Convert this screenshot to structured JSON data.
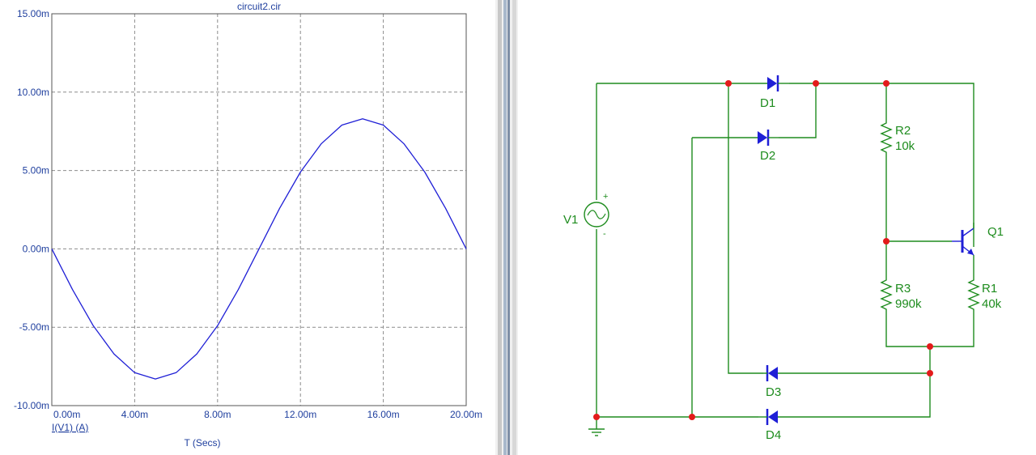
{
  "colors": {
    "axis_text": "#1f3f9e",
    "trace": "#1f1fd6",
    "grid": "#8c8c8c",
    "wire": "#1e8c1e",
    "node": "#e31b1b",
    "diode": "#1f1fd6",
    "label": "#1e8c1e"
  },
  "chart_data": {
    "type": "line",
    "title": "circuit2.cir",
    "xlabel": "T (Secs)",
    "ylabel": "",
    "trace_label": "I(V1) (A)",
    "xlim": [
      0,
      0.02
    ],
    "ylim": [
      -0.01,
      0.015
    ],
    "grid": true,
    "x_ticks": [
      0,
      0.004,
      0.008,
      0.012,
      0.016,
      0.02
    ],
    "x_tick_labels": [
      "0.00m",
      "4.00m",
      "8.00m",
      "12.00m",
      "16.00m",
      "20.00m"
    ],
    "y_ticks": [
      -0.01,
      -0.005,
      0,
      0.005,
      0.01,
      0.015
    ],
    "y_tick_labels": [
      "-10.00m",
      "-5.00m",
      "0.00m",
      "5.00m",
      "10.00m",
      "15.00m"
    ],
    "series": [
      {
        "x": [
          0,
          0.001,
          0.002,
          0.003,
          0.004,
          0.005,
          0.006,
          0.007,
          0.008,
          0.009,
          0.01,
          0.011,
          0.012,
          0.013,
          0.014,
          0.015,
          0.016,
          0.017,
          0.018,
          0.019,
          0.02
        ],
        "values": [
          0,
          -0.0026,
          -0.0049,
          -0.0067,
          -0.0079,
          -0.0083,
          -0.0079,
          -0.0067,
          -0.0049,
          -0.0026,
          0,
          0.0026,
          0.0049,
          0.0067,
          0.0079,
          0.0083,
          0.0079,
          0.0067,
          0.0049,
          0.0026,
          0
        ]
      }
    ]
  },
  "schematic": {
    "labels": {
      "D1": "D1",
      "D2": "D2",
      "D3": "D3",
      "D4": "D4",
      "R2": "R2",
      "R2_val": "10k",
      "R3": "R3",
      "R3_val": "990k",
      "R1": "R1",
      "R1_val": "40k",
      "Q1": "Q1",
      "V1": "V1",
      "V1_plus": "+",
      "V1_minus": "-"
    }
  }
}
